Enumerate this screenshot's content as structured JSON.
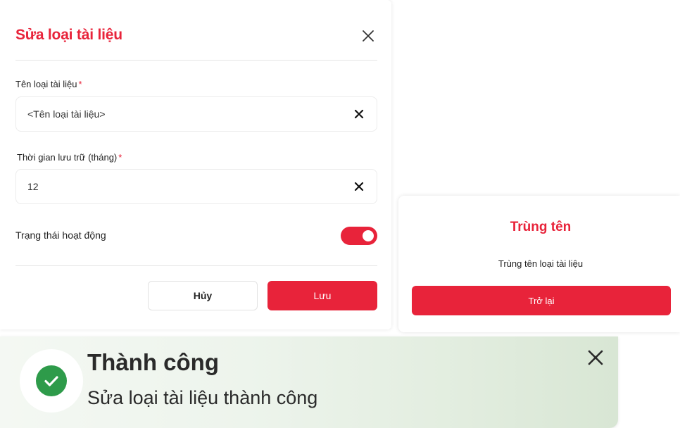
{
  "edit_modal": {
    "title": "Sửa loại tài liệu",
    "close_icon": "close-icon",
    "fields": {
      "name": {
        "label": "Tên loại tài liệu",
        "required_mark": "*",
        "value": "<Tên loại tài liệu>",
        "clear_icon": "clear-icon"
      },
      "retention": {
        "label": "Thời gian lưu trữ (tháng)",
        "required_mark": "*",
        "value": "12",
        "clear_icon": "clear-icon"
      }
    },
    "status": {
      "label": "Trạng thái hoạt động",
      "enabled": true
    },
    "buttons": {
      "cancel": "Hủy",
      "save": "Lưu"
    }
  },
  "duplicate_dialog": {
    "title": "Trùng tên",
    "message": "Trùng tên loại tài liệu",
    "back_button": "Trở lại"
  },
  "toast": {
    "title": "Thành công",
    "message": "Sửa loại tài liệu thành công",
    "icon": "check-circle-icon",
    "close_icon": "close-icon"
  },
  "colors": {
    "accent": "#e8233a",
    "success": "#2e9b4a",
    "text": "#222222"
  }
}
